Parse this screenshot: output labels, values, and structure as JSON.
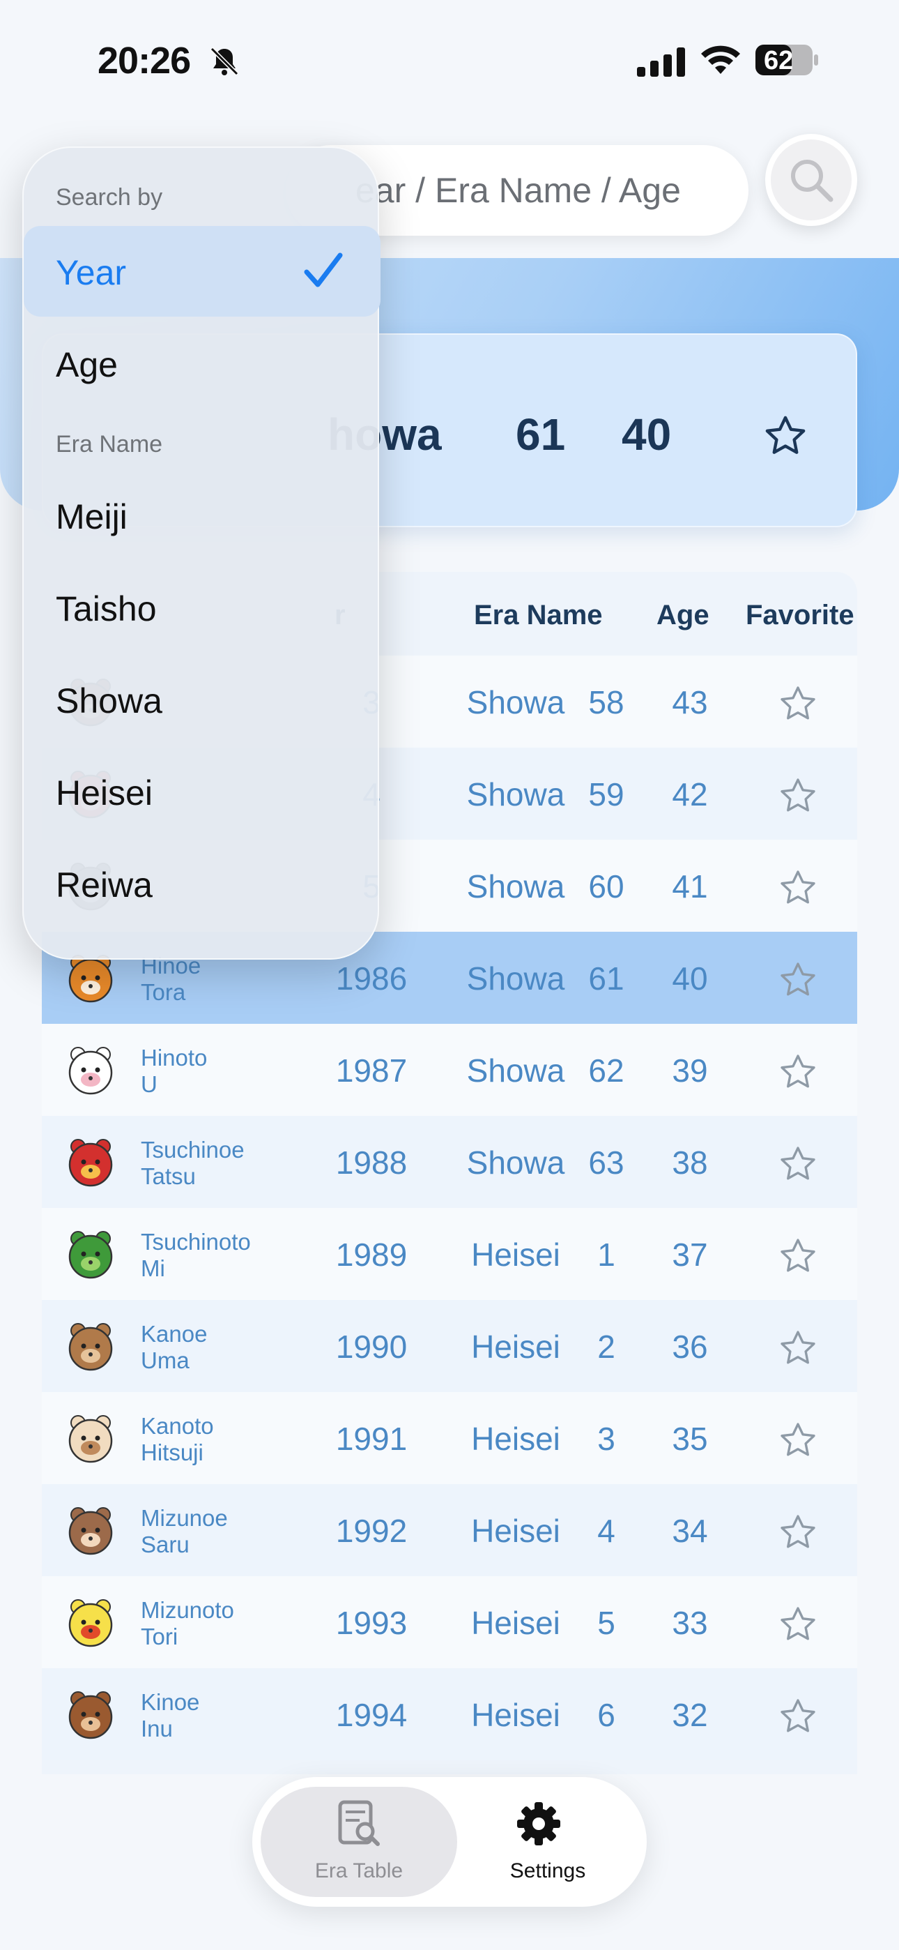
{
  "status_bar": {
    "time": "20:26",
    "battery": "62",
    "icons": [
      "bell-slash-icon",
      "cellular-signal-icon",
      "wifi-icon",
      "battery-icon"
    ]
  },
  "search": {
    "placeholder": "ear / Era Name / Age",
    "button_icon": "magnifier-icon"
  },
  "hero": {
    "era": "howa",
    "era_year": "61",
    "age": "40",
    "favorite_icon": "star-outline-icon"
  },
  "table": {
    "headers": {
      "year": "r",
      "era_name": "Era Name",
      "age": "Age",
      "favorite": "Favorite"
    },
    "rows": [
      {
        "zodiac1": "",
        "zodiac2": "",
        "year": "3",
        "era": "Showa",
        "era_year": "58",
        "age": "43",
        "animal": "boar"
      },
      {
        "zodiac1": "",
        "zodiac2": "",
        "year": "4",
        "era": "Showa",
        "era_year": "59",
        "age": "42",
        "animal": "rat"
      },
      {
        "zodiac1": "",
        "zodiac2": "",
        "year": "5",
        "era": "Showa",
        "era_year": "60",
        "age": "41",
        "animal": "ox"
      },
      {
        "zodiac1": "Hinoe",
        "zodiac2": "Tora",
        "year": "1986",
        "era": "Showa",
        "era_year": "61",
        "age": "40",
        "animal": "tiger",
        "selected": true
      },
      {
        "zodiac1": "Hinoto",
        "zodiac2": "U",
        "year": "1987",
        "era": "Showa",
        "era_year": "62",
        "age": "39",
        "animal": "rabbit"
      },
      {
        "zodiac1": "Tsuchinoe",
        "zodiac2": "Tatsu",
        "year": "1988",
        "era": "Showa",
        "era_year": "63",
        "age": "38",
        "animal": "dragon"
      },
      {
        "zodiac1": "Tsuchinoto",
        "zodiac2": "Mi",
        "year": "1989",
        "era": "Heisei",
        "era_year": "1",
        "age": "37",
        "animal": "snake"
      },
      {
        "zodiac1": "Kanoe",
        "zodiac2": "Uma",
        "year": "1990",
        "era": "Heisei",
        "era_year": "2",
        "age": "36",
        "animal": "horse"
      },
      {
        "zodiac1": "Kanoto",
        "zodiac2": "Hitsuji",
        "year": "1991",
        "era": "Heisei",
        "era_year": "3",
        "age": "35",
        "animal": "sheep"
      },
      {
        "zodiac1": "Mizunoe",
        "zodiac2": "Saru",
        "year": "1992",
        "era": "Heisei",
        "era_year": "4",
        "age": "34",
        "animal": "monkey"
      },
      {
        "zodiac1": "Mizunoto",
        "zodiac2": "Tori",
        "year": "1993",
        "era": "Heisei",
        "era_year": "5",
        "age": "33",
        "animal": "rooster"
      },
      {
        "zodiac1": "Kinoe",
        "zodiac2": "Inu",
        "year": "1994",
        "era": "Heisei",
        "era_year": "6",
        "age": "32",
        "animal": "dog"
      }
    ]
  },
  "menu": {
    "section_search_by": "Search by",
    "year": "Year",
    "age": "Age",
    "section_era": "Era Name",
    "eras": [
      "Meiji",
      "Taisho",
      "Showa",
      "Heisei",
      "Reiwa"
    ],
    "selected": "Year"
  },
  "tabbar": {
    "era_table": "Era Table",
    "settings": "Settings"
  },
  "colors": {
    "accent": "#1a7cf0",
    "cell_text": "#4a88c4",
    "selected_row": "#a8cdf5",
    "header_text": "#1d3b5c"
  }
}
